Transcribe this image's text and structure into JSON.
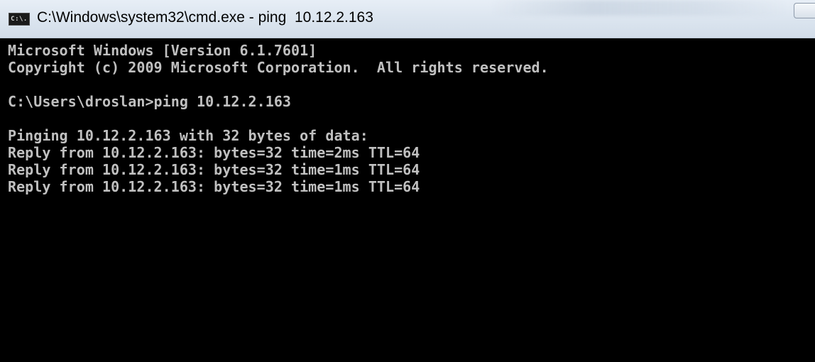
{
  "window": {
    "title": "C:\\Windows\\system32\\cmd.exe - ping  10.12.2.163",
    "icon": "cmd-icon",
    "icon_label": "C:\\."
  },
  "console": {
    "lines": [
      "Microsoft Windows [Version 6.1.7601]",
      "Copyright (c) 2009 Microsoft Corporation.  All rights reserved.",
      "",
      "C:\\Users\\droslan>ping 10.12.2.163",
      "",
      "Pinging 10.12.2.163 with 32 bytes of data:",
      "Reply from 10.12.2.163: bytes=32 time=2ms TTL=64",
      "Reply from 10.12.2.163: bytes=32 time=1ms TTL=64",
      "Reply from 10.12.2.163: bytes=32 time=1ms TTL=64"
    ]
  },
  "colors": {
    "console_background": "#000000",
    "console_text": "#c0c0c0",
    "titlebar_background": "#dde6f0"
  }
}
